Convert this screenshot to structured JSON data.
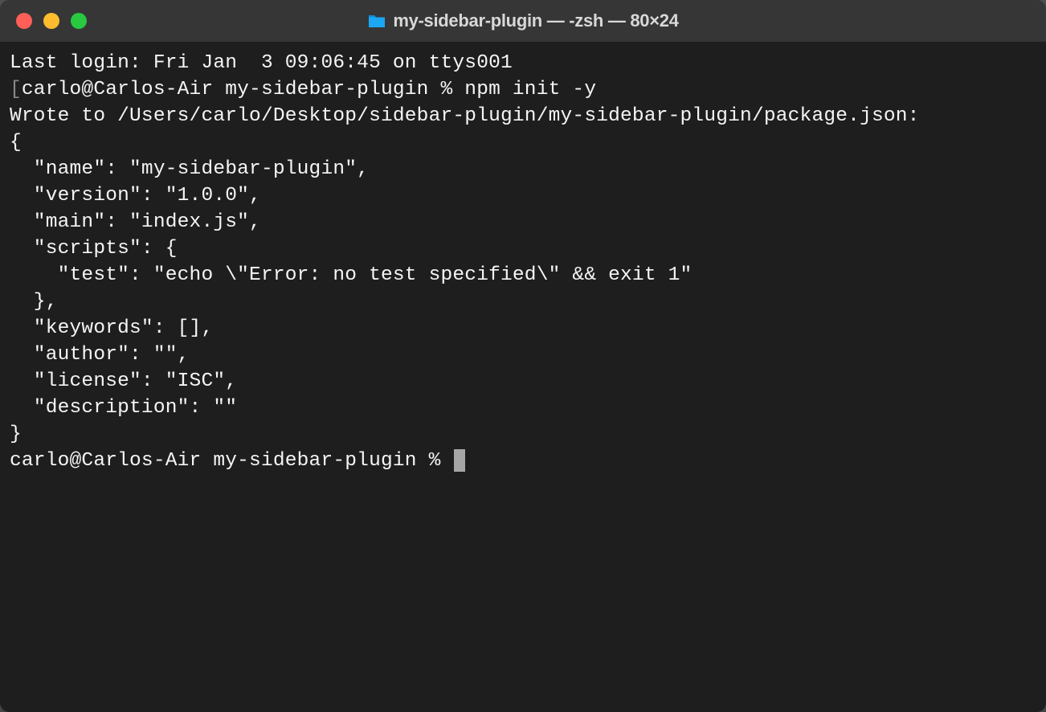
{
  "window": {
    "title": "my-sidebar-plugin — -zsh — 80×24"
  },
  "terminal": {
    "lastLogin": "Last login: Fri Jan  3 09:06:45 on ttys001",
    "promptBracketOpen": "[",
    "promptBracketClose": "]",
    "prompt1": "carlo@Carlos-Air my-sidebar-plugin % ",
    "command1": "npm init -y",
    "output1": "Wrote to /Users/carlo/Desktop/sidebar-plugin/my-sidebar-plugin/package.json:",
    "blank1": "",
    "jsonOpen": "{",
    "jsonName": "  \"name\": \"my-sidebar-plugin\",",
    "jsonVersion": "  \"version\": \"1.0.0\",",
    "jsonMain": "  \"main\": \"index.js\",",
    "jsonScriptsOpen": "  \"scripts\": {",
    "jsonTest": "    \"test\": \"echo \\\"Error: no test specified\\\" && exit 1\"",
    "jsonScriptsClose": "  },",
    "jsonKeywords": "  \"keywords\": [],",
    "jsonAuthor": "  \"author\": \"\",",
    "jsonLicense": "  \"license\": \"ISC\",",
    "jsonDescription": "  \"description\": \"\"",
    "jsonClose": "}",
    "blank2": "",
    "blank3": "",
    "prompt2": "carlo@Carlos-Air my-sidebar-plugin % "
  }
}
